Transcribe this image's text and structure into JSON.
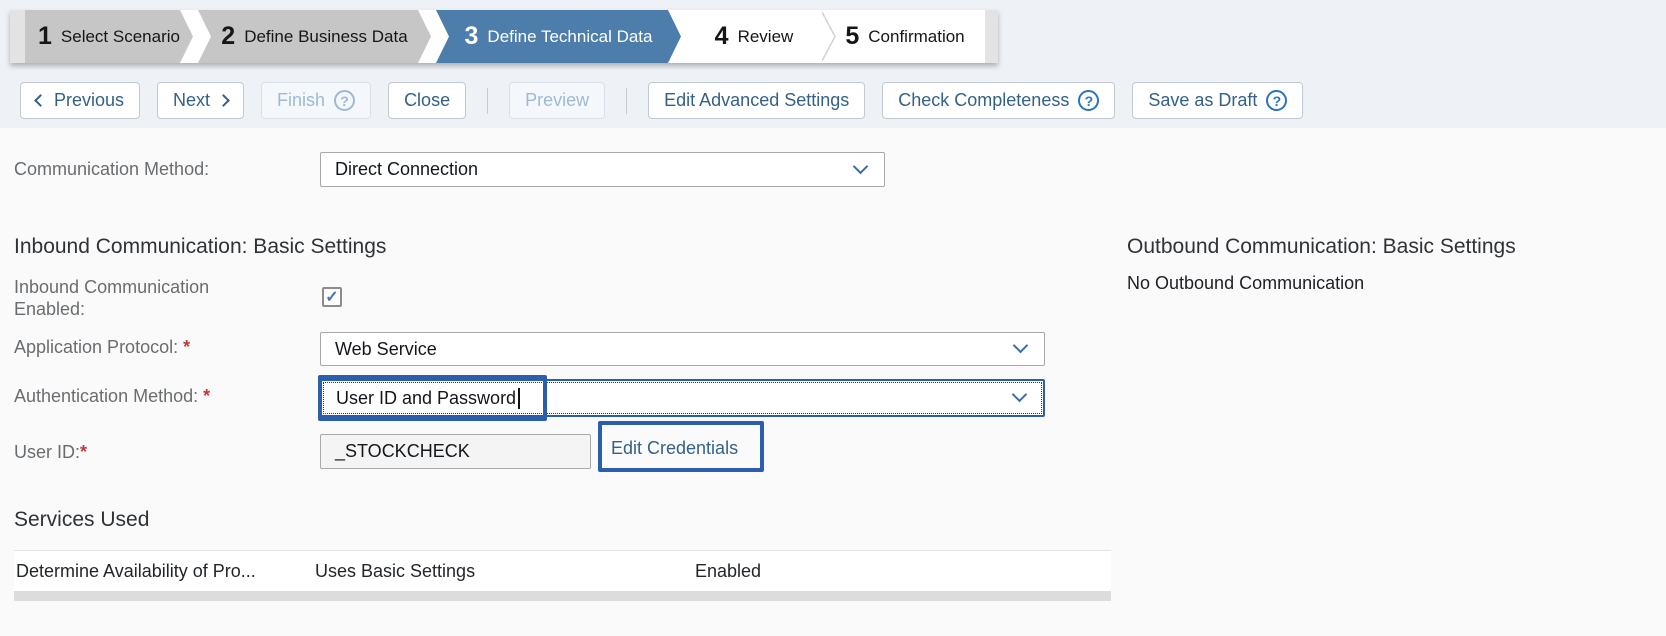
{
  "wizard": {
    "steps": [
      {
        "number": "1",
        "label": "Select Scenario",
        "state": "done"
      },
      {
        "number": "2",
        "label": "Define Business Data",
        "state": "done"
      },
      {
        "number": "3",
        "label": "Define Technical Data",
        "state": "active"
      },
      {
        "number": "4",
        "label": "Review",
        "state": "upcoming"
      },
      {
        "number": "5",
        "label": "Confirmation",
        "state": "upcoming"
      }
    ]
  },
  "toolbar": {
    "previous_label": "Previous",
    "next_label": "Next",
    "finish_label": "Finish",
    "close_label": "Close",
    "preview_label": "Preview",
    "edit_advanced_label": "Edit Advanced Settings",
    "check_completeness_label": "Check Completeness",
    "save_draft_label": "Save as Draft"
  },
  "form": {
    "communication_method": {
      "label": "Communication Method:",
      "value": "Direct Connection"
    },
    "inbound": {
      "heading": "Inbound Communication: Basic Settings",
      "enabled": {
        "label": "Inbound Communication Enabled:",
        "checked": true
      },
      "application_protocol": {
        "label": "Application Protocol:",
        "required": "*",
        "value": "Web Service"
      },
      "authentication_method": {
        "label": "Authentication Method:",
        "required": "*",
        "value": "User ID and Password"
      },
      "user_id": {
        "label": "User ID:",
        "required": "*",
        "value": "_STOCKCHECK",
        "action_label": "Edit Credentials"
      }
    },
    "outbound": {
      "heading": "Outbound Communication: Basic Settings",
      "empty_text": "No Outbound Communication"
    }
  },
  "services": {
    "heading": "Services Used",
    "rows": [
      {
        "name": "Determine Availability of Pro...",
        "settings": "Uses Basic Settings",
        "status": "Enabled"
      }
    ]
  },
  "icons": {
    "help": "?",
    "check": "✓"
  },
  "colors": {
    "active_step": "#4d7dab",
    "annotation_highlight": "#2b5fad",
    "button_text": "#346187"
  }
}
